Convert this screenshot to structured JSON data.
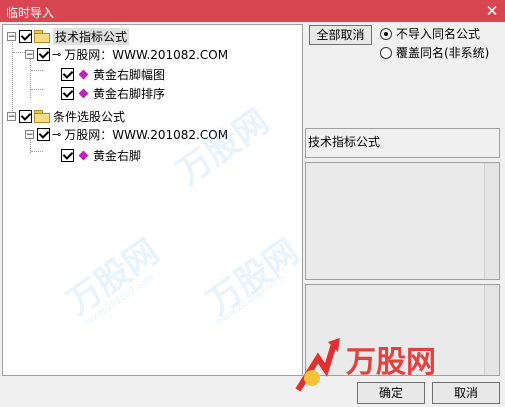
{
  "window": {
    "title": "临时导入",
    "close_glyph": "✕"
  },
  "tree": {
    "root1": {
      "label": "技术指标公式"
    },
    "root1_child": {
      "label": "万股网：WWW.201082.COM"
    },
    "root1_leaf1": {
      "label": "黄金右脚幅图"
    },
    "root1_leaf2": {
      "label": "黄金右脚排序"
    },
    "root2": {
      "label": "条件选股公式"
    },
    "root2_child": {
      "label": "万股网：WWW.201082.COM"
    },
    "root2_leaf1": {
      "label": "黄金右脚"
    }
  },
  "options": {
    "deselect_all": "全部取消",
    "radio_skip": "不导入同名公式",
    "radio_overwrite": "覆盖同名(非系统)",
    "selected": "radio_skip"
  },
  "info": {
    "type_label": "技术指标公式"
  },
  "footer": {
    "ok_label": "确定",
    "cancel_label": "取消"
  },
  "watermark": {
    "brand": "万股网",
    "url": "www.201082.com"
  },
  "colors": {
    "titlebar": "#d84751",
    "accent": "#4ba3e3",
    "formula_diamond": "#c020c0"
  }
}
